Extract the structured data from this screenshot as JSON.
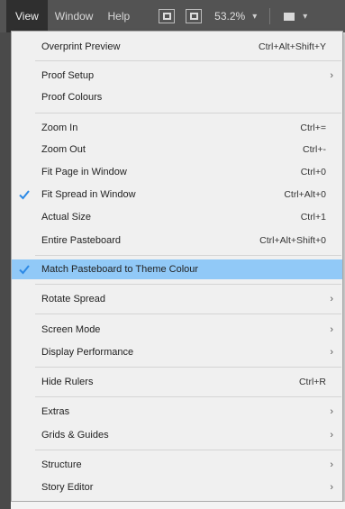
{
  "menubar": {
    "active_menu": "View",
    "items": [
      "Window",
      "Help"
    ],
    "zoom": "53.2%"
  },
  "menu": {
    "items": [
      {
        "label": "Overprint Preview",
        "shortcut": "Ctrl+Alt+Shift+Y"
      },
      {
        "label": "Proof Setup",
        "submenu": true
      },
      {
        "label": "Proof Colours"
      },
      {
        "label": "Zoom In",
        "shortcut": "Ctrl+="
      },
      {
        "label": "Zoom Out",
        "shortcut": "Ctrl+-"
      },
      {
        "label": "Fit Page in Window",
        "shortcut": "Ctrl+0"
      },
      {
        "label": "Fit Spread in Window",
        "shortcut": "Ctrl+Alt+0",
        "checked": true
      },
      {
        "label": "Actual Size",
        "shortcut": "Ctrl+1"
      },
      {
        "label": "Entire Pasteboard",
        "shortcut": "Ctrl+Alt+Shift+0"
      },
      {
        "label": "Match Pasteboard to Theme Colour",
        "checked": true,
        "highlighted": true
      },
      {
        "label": "Rotate Spread",
        "submenu": true
      },
      {
        "label": "Screen Mode",
        "submenu": true
      },
      {
        "label": "Display Performance",
        "submenu": true
      },
      {
        "label": "Hide Rulers",
        "shortcut": "Ctrl+R"
      },
      {
        "label": "Extras",
        "submenu": true
      },
      {
        "label": "Grids & Guides",
        "submenu": true
      },
      {
        "label": "Structure",
        "submenu": true
      },
      {
        "label": "Story Editor",
        "submenu": true
      }
    ]
  },
  "colors": {
    "menubar_bg": "#535353",
    "menu_bg": "#f0f0f0",
    "highlight": "#91c9f7",
    "check": "#2d8ae6"
  }
}
